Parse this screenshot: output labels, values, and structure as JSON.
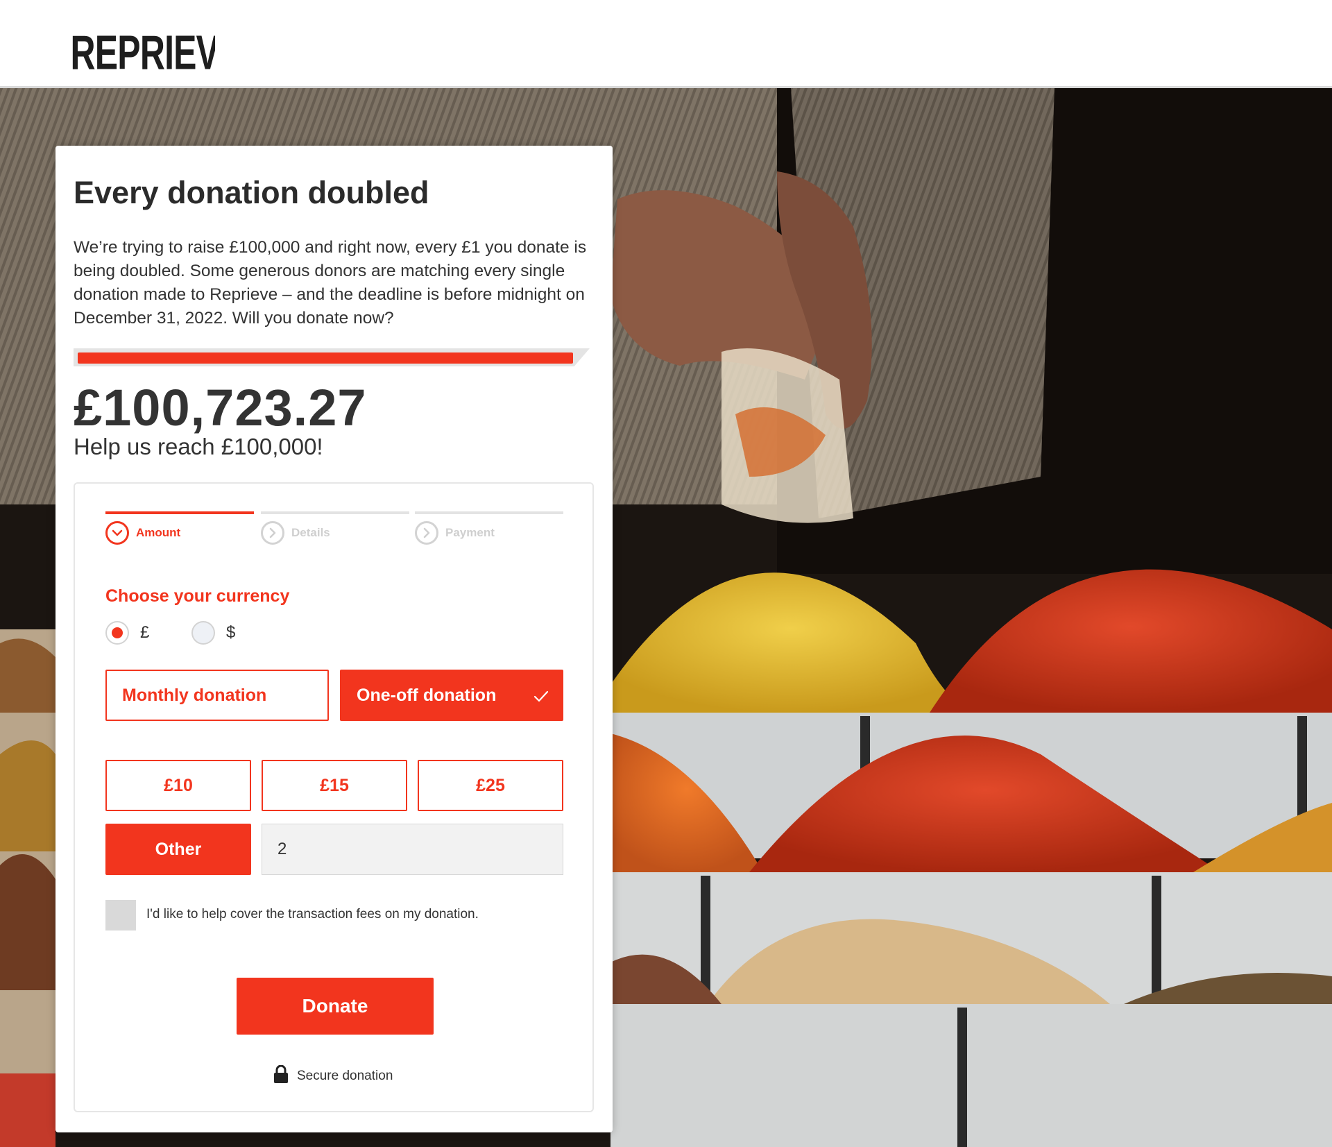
{
  "brand": {
    "logo_text": "REPRIEVE"
  },
  "colors": {
    "accent": "#f2351e",
    "text": "#333333",
    "inactive": "#d3d3d3"
  },
  "campaign": {
    "title": "Every donation doubled",
    "intro": "We’re trying to raise £100,000 and right now, every £1 you donate is being doubled. Some generous donors are matching every single donation made to Reprieve – and the deadline is before midnight on December 31, 2022. Will you donate now?",
    "progress_fraction": 1.0,
    "raised": "£100,723.27",
    "goal_text": "Help us reach £100,000!"
  },
  "steps": [
    {
      "label": "Amount",
      "state": "active",
      "icon": "chevron-down-icon"
    },
    {
      "label": "Details",
      "state": "inactive",
      "icon": "chevron-right-icon"
    },
    {
      "label": "Payment",
      "state": "inactive",
      "icon": "chevron-right-icon"
    }
  ],
  "currency": {
    "title": "Choose your currency",
    "options": [
      {
        "symbol": "£",
        "selected": true
      },
      {
        "symbol": "$",
        "selected": false
      }
    ]
  },
  "donation_type": {
    "monthly_label": "Monthly donation",
    "oneoff_label": "One-off donation",
    "selected": "one-off",
    "check_icon": "check-icon"
  },
  "amounts": {
    "options": [
      "£10",
      "£15",
      "£25"
    ],
    "other_label": "Other",
    "other_value": "2"
  },
  "fees": {
    "label": "I'd like to help cover the transaction fees on my donation.",
    "checked": false
  },
  "donate_label": "Donate",
  "secure_label": "Secure donation",
  "secure_icon": "lock-icon"
}
